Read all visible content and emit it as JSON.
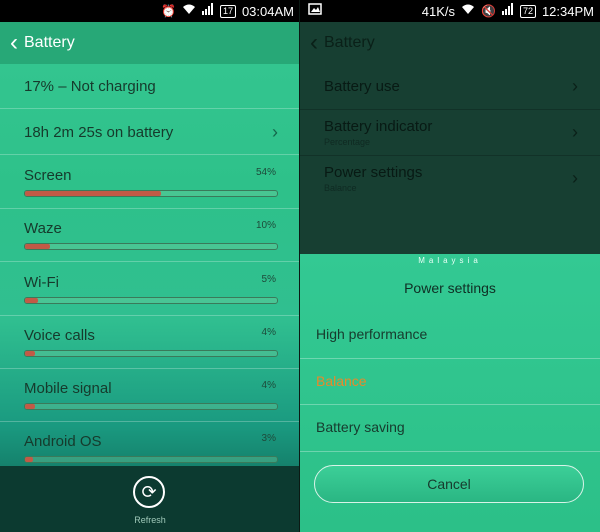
{
  "left": {
    "status": {
      "time": "03:04AM",
      "battery": "17",
      "icons": [
        "alarm-icon",
        "wifi-icon",
        "signal-icon"
      ]
    },
    "header": {
      "back": "‹",
      "title": "Battery"
    },
    "summary": {
      "level": "17% – Not charging",
      "uptime": "18h 2m 25s on battery"
    },
    "usage": [
      {
        "label": "Screen",
        "pct": "54%",
        "fraction": 0.54
      },
      {
        "label": "Waze",
        "pct": "10%",
        "fraction": 0.1
      },
      {
        "label": "Wi-Fi",
        "pct": "5%",
        "fraction": 0.05
      },
      {
        "label": "Voice calls",
        "pct": "4%",
        "fraction": 0.04
      },
      {
        "label": "Mobile signal",
        "pct": "4%",
        "fraction": 0.04
      },
      {
        "label": "Android OS",
        "pct": "3%",
        "fraction": 0.03
      }
    ],
    "refresh_label": "Refresh",
    "colors": {
      "accent": "#27a877",
      "bar_fill": "#c25a46"
    }
  },
  "right": {
    "status": {
      "speed": "41K/s",
      "battery": "72",
      "time": "12:34PM"
    },
    "header": {
      "back": "‹",
      "title": "Battery"
    },
    "menu": {
      "battery_use": "Battery use",
      "battery_indicator": "Battery indicator",
      "battery_indicator_value": "Percentage",
      "power_settings": "Power settings",
      "power_settings_value": "Balance"
    },
    "sheet": {
      "watermark": "Malaysia",
      "title": "Power settings",
      "options": [
        "High performance",
        "Balance",
        "Battery saving"
      ],
      "selected": "Balance",
      "cancel": "Cancel",
      "selected_color": "#e7892b"
    }
  }
}
